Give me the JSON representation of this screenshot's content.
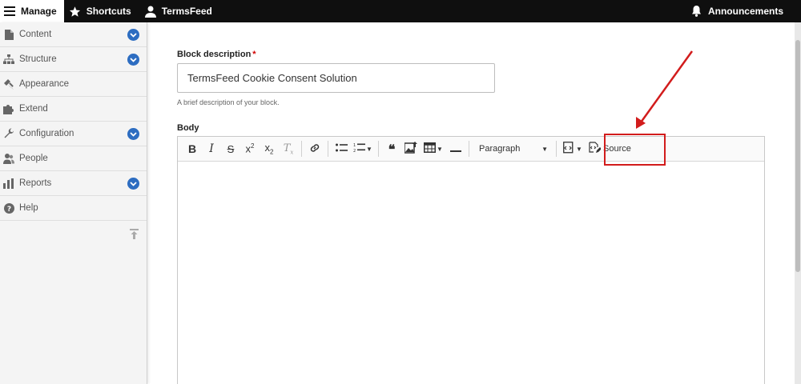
{
  "topbar": {
    "manage_label": "Manage",
    "shortcuts_label": "Shortcuts",
    "user_label": "TermsFeed",
    "announcements_label": "Announcements"
  },
  "sidebar": {
    "items": [
      {
        "label": "Content",
        "icon": "document-icon",
        "expandable": true
      },
      {
        "label": "Structure",
        "icon": "sitemap-icon",
        "expandable": true
      },
      {
        "label": "Appearance",
        "icon": "brush-icon",
        "expandable": false
      },
      {
        "label": "Extend",
        "icon": "puzzle-icon",
        "expandable": false
      },
      {
        "label": "Configuration",
        "icon": "wrench-icon",
        "expandable": true
      },
      {
        "label": "People",
        "icon": "people-icon",
        "expandable": false
      },
      {
        "label": "Reports",
        "icon": "bar-chart-icon",
        "expandable": true
      },
      {
        "label": "Help",
        "icon": "help-icon",
        "expandable": false
      }
    ]
  },
  "form": {
    "block_description_label": "Block description",
    "required_mark": "*",
    "block_description_value": "TermsFeed Cookie Consent Solution",
    "help_text": "A brief description of your block.",
    "body_label": "Body"
  },
  "editor": {
    "heading_select_value": "Paragraph",
    "source_label": "Source"
  },
  "colors": {
    "topbar_bg": "#0f0f0f",
    "accent_blue": "#2d6dc1",
    "highlight_red": "#d21c1c",
    "required_red": "#d10000"
  }
}
